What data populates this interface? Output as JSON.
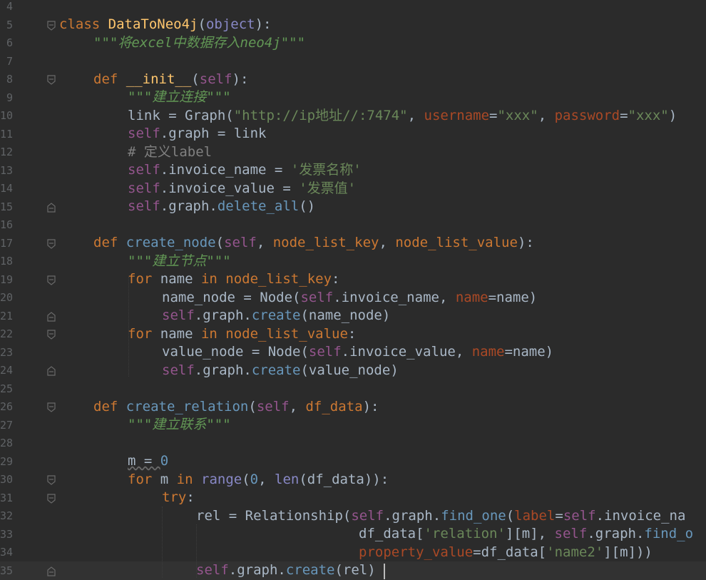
{
  "line_numbers": [
    "4",
    "5",
    "6",
    "7",
    "8",
    "9",
    "10",
    "11",
    "12",
    "13",
    "14",
    "15",
    "16",
    "17",
    "18",
    "19",
    "20",
    "21",
    "22",
    "23",
    "24",
    "25",
    "26",
    "27",
    "28",
    "29",
    "30",
    "31",
    "32",
    "33",
    "34",
    "35"
  ],
  "code": {
    "l5": {
      "kw": "class",
      "name": "DataToNeo4j",
      "open": "(",
      "base": "object",
      "close": "):"
    },
    "l6": {
      "doc": "\"\"\"将excel中数据存入neo4j\"\"\""
    },
    "l8": {
      "kw": "def",
      "name": "__init__",
      "open": "(",
      "self": "self",
      "close": "):"
    },
    "l9": {
      "doc": "\"\"\"建立连接\"\"\""
    },
    "l10": {
      "a": "link = Graph(",
      "s1": "\"http://ip地址//:7474\"",
      "c1": ", ",
      "k1": "username",
      "eq1": "=",
      "s2": "\"xxx\"",
      "c2": ", ",
      "k2": "password",
      "eq2": "=",
      "s3": "\"xxx\"",
      "end": ")"
    },
    "l11": {
      "self": "self",
      "rest": ".graph = link"
    },
    "l12": {
      "cmt": "# 定义label"
    },
    "l13": {
      "self": "self",
      "rest": ".invoice_name = ",
      "str": "'发票名称'"
    },
    "l14": {
      "self": "self",
      "rest": ".invoice_value = ",
      "str": "'发票值'"
    },
    "l15": {
      "self": "self",
      "rest": ".graph.",
      "call": "delete_all",
      "end": "()"
    },
    "l17": {
      "kw": "def",
      "name": "create_node",
      "open": "(",
      "self": "self",
      "c1": ", ",
      "p1": "node_list_key",
      "c2": ", ",
      "p2": "node_list_value",
      "close": "):"
    },
    "l18": {
      "doc": "\"\"\"建立节点\"\"\""
    },
    "l19": {
      "kw": "for",
      "v": " name ",
      "in": "in",
      "it": " node_list_key",
      "colon": ":"
    },
    "l20": {
      "a": "name_node = Node(",
      "self": "self",
      "b": ".invoice_name, ",
      "k": "name",
      "eq": "=",
      "c": "name)"
    },
    "l21": {
      "self": "self",
      "rest": ".graph.",
      "call": "create",
      "end": "(name_node)"
    },
    "l22": {
      "kw": "for",
      "v": " name ",
      "in": "in",
      "it": " node_list_value",
      "colon": ":"
    },
    "l23": {
      "a": "value_node = Node(",
      "self": "self",
      "b": ".invoice_value, ",
      "k": "name",
      "eq": "=",
      "c": "name)"
    },
    "l24": {
      "self": "self",
      "rest": ".graph.",
      "call": "create",
      "end": "(value_node)"
    },
    "l26": {
      "kw": "def",
      "name": "create_relation",
      "open": "(",
      "self": "self",
      "c1": ", ",
      "p1": "df_data",
      "close": "):"
    },
    "l27": {
      "doc": "\"\"\"建立联系\"\"\""
    },
    "l29": {
      "a": "m = ",
      "num": "0"
    },
    "l30": {
      "kw": "for",
      "a": " m ",
      "in": "in",
      "b": " ",
      "builtin": "range",
      "c": "(",
      "num": "0",
      ",": ", ",
      "len": "len",
      "d": "(df_data)):"
    },
    "l31": {
      "kw": "try",
      "colon": ":"
    },
    "l32": {
      "a": "rel = Relationship(",
      "self": "self",
      "b": ".graph.",
      "call": "find_one",
      "c": "(",
      "k": "label",
      "eq": "=",
      "self2": "self",
      "d": ".invoice_na"
    },
    "l33": {
      "a": "df_data[",
      "str": "'relation'",
      "b": "][m], ",
      "self": "self",
      "c": ".graph.",
      "call": "find_o"
    },
    "l34": {
      "k": "property_value",
      "eq": "=",
      "a": "df_data[",
      "str": "'name2'",
      "b": "][m]))"
    },
    "l35": {
      "self": "self",
      "rest": ".graph.",
      "call": "create",
      "end": "(rel)"
    }
  }
}
